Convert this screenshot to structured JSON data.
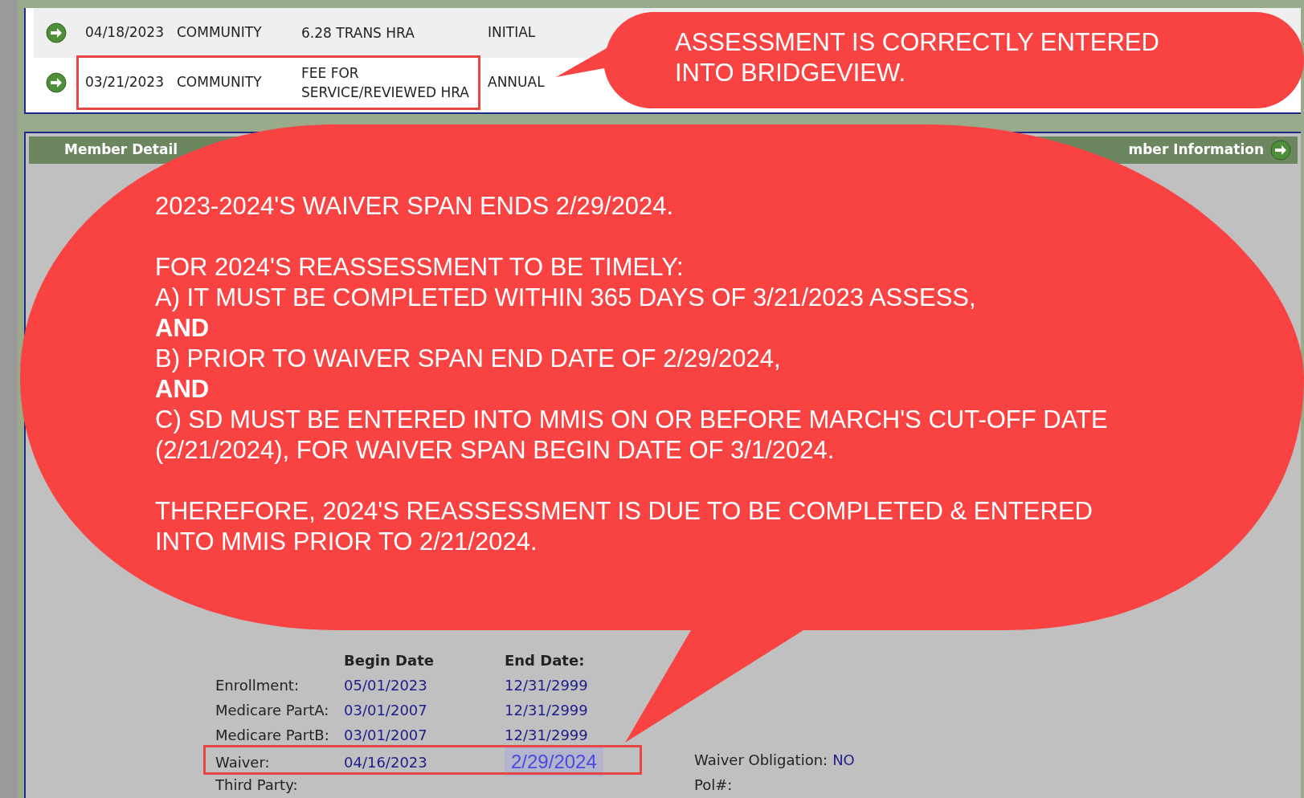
{
  "records": [
    {
      "date": "04/18/2023",
      "setting": "COMMUNITY",
      "type": "6.28 TRANS HRA",
      "reason": "INITIAL",
      "highlighted": false
    },
    {
      "date": "03/21/2023",
      "setting": "COMMUNITY",
      "type": "FEE FOR SERVICE/REVIEWED HRA",
      "reason": "ANNUAL",
      "highlighted": true
    }
  ],
  "member_panel": {
    "title": "Member Detail",
    "link": "mber Information",
    "columns": [
      "Begin Date",
      "End Date:"
    ],
    "rows": [
      {
        "label": "Enrollment:",
        "begin": "05/01/2023",
        "end": "12/31/2999",
        "highlighted": false
      },
      {
        "label": "Medicare PartA:",
        "begin": "03/01/2007",
        "end": "12/31/2999",
        "highlighted": false
      },
      {
        "label": "Medicare PartB:",
        "begin": "03/01/2007",
        "end": "12/31/2999",
        "highlighted": false
      },
      {
        "label": "Waiver:",
        "begin": "04/16/2023",
        "end": "2/29/2024",
        "highlighted": true,
        "end_edited": true
      },
      {
        "label": "Third Party:",
        "highlighted": false
      }
    ],
    "side_fields": [
      {
        "label": "Waiver Obligation:",
        "value": "NO"
      },
      {
        "label": "Pol#:"
      }
    ]
  },
  "callouts": [
    {
      "kind": "small",
      "paragraphs": [
        [
          "ASSESSMENT IS CORRECTLY ENTERED",
          "INTO BRIDGEVIEW."
        ]
      ]
    },
    {
      "kind": "large",
      "paragraphs": [
        [
          "2023-2024'S WAIVER SPAN ENDS 2/29/2024."
        ],
        [
          "FOR 2024'S REASSESSMENT TO BE TIMELY:",
          "A) IT MUST BE COMPLETED WITHIN 365 DAYS OF 3/21/2023 ASSESS,",
          "**AND**",
          "B) PRIOR TO WAIVER SPAN END DATE OF 2/29/2024,",
          "**AND**",
          "C) SD MUST BE ENTERED INTO MMIS ON OR BEFORE MARCH'S CUT-OFF DATE",
          "(2/21/2024), FOR WAIVER SPAN BEGIN DATE OF 3/1/2024."
        ],
        [
          "THEREFORE, 2024'S REASSESSMENT IS DUE TO BE COMPLETED & ENTERED",
          "INTO MMIS PRIOR TO 2/21/2024."
        ]
      ]
    }
  ]
}
